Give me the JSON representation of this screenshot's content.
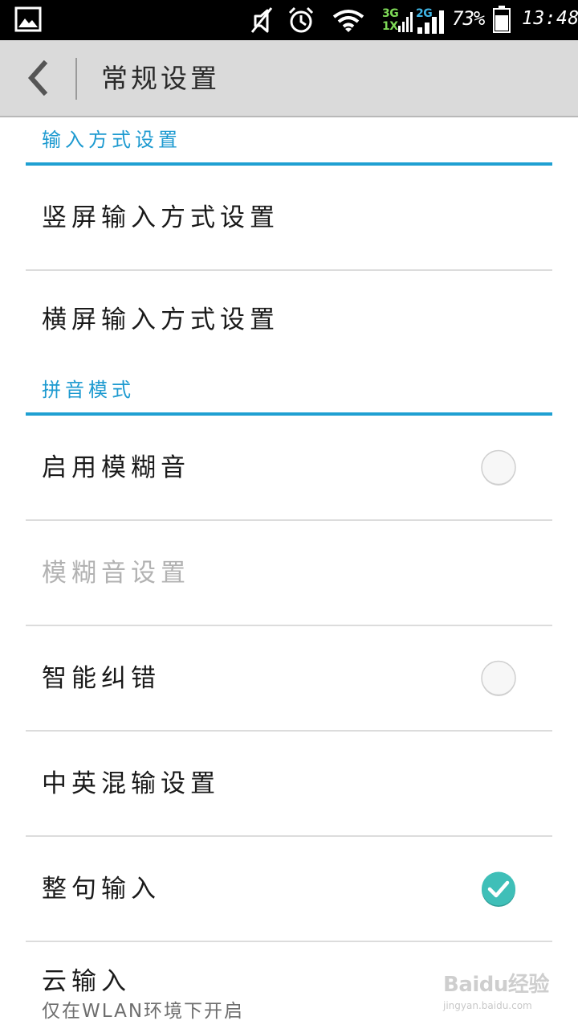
{
  "status_bar": {
    "network_1": "3G",
    "network_2": "2G",
    "network_3": "1X",
    "battery_percent": "73%",
    "time": "13:48",
    "icons": [
      "photo-icon",
      "mute-icon",
      "alarm-icon",
      "wifi-icon",
      "signal-icon",
      "battery-icon"
    ]
  },
  "action_bar": {
    "title": "常规设置",
    "back_icon": "chevron-left-icon"
  },
  "sections": [
    {
      "header": "输入方式设置",
      "items": [
        {
          "title": "竖屏输入方式设置"
        },
        {
          "title": "横屏输入方式设置"
        }
      ]
    },
    {
      "header": "拼音模式",
      "items": [
        {
          "title": "启用模糊音",
          "checked": false
        },
        {
          "title": "模糊音设置",
          "enabled": false
        },
        {
          "title": "智能纠错",
          "checked": false
        },
        {
          "title": "中英混输设置"
        },
        {
          "title": "整句输入",
          "checked": true
        },
        {
          "title": "云输入",
          "summary": "仅在WLAN环境下开启"
        }
      ]
    }
  ],
  "watermark": {
    "logo": "Baidu经验",
    "url": "jingyan.baidu.com"
  },
  "colors": {
    "accent": "#1fa0d2",
    "checked": "#3fbfb8",
    "action_bar_bg": "#dadada",
    "status_bar_bg": "#000000"
  }
}
